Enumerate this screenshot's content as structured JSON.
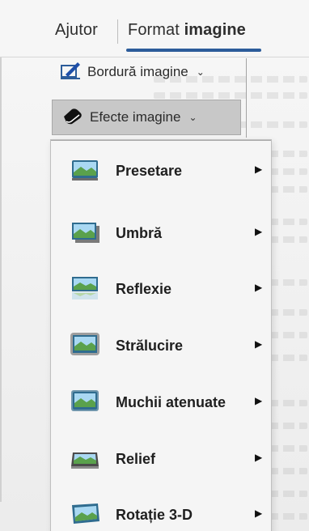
{
  "ribbon": {
    "tab_help": "Ajutor",
    "tab_format_prefix": "Format ",
    "tab_format_bold": "imagine",
    "border_button": "Bordură imagine",
    "effects_button": "Efecte imagine"
  },
  "menu": {
    "items": [
      {
        "label": "Presetare",
        "icon": "preset-icon"
      },
      {
        "label": "Umbră",
        "icon": "shadow-icon"
      },
      {
        "label": "Reflexie",
        "icon": "reflection-icon"
      },
      {
        "label": "Strălucire",
        "icon": "glow-icon"
      },
      {
        "label": "Muchii atenuate",
        "icon": "soft-edges-icon"
      },
      {
        "label": "Relief",
        "icon": "bevel-icon"
      },
      {
        "label": "Rotație 3-D",
        "icon": "rotation-3d-icon"
      }
    ]
  },
  "colors": {
    "accent": "#2c5c9a",
    "highlight": "#c8c8c8"
  }
}
